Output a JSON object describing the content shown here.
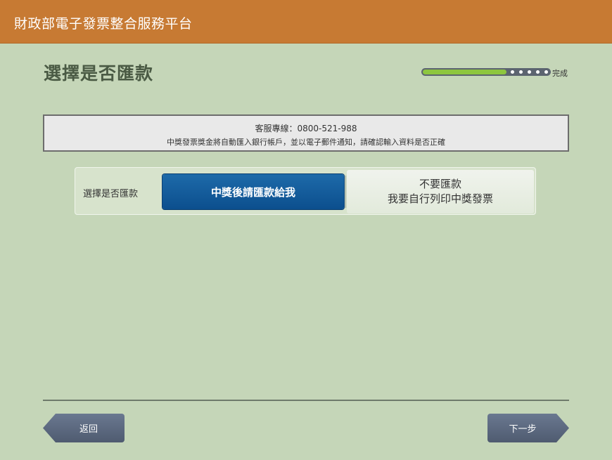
{
  "header": {
    "title": "財政部電子發票整合服務平台"
  },
  "page": {
    "title": "選擇是否匯款"
  },
  "progress": {
    "label": "完成",
    "fraction": 0.66
  },
  "notice": {
    "hotline": "客服專線：0800-521-988",
    "message": "中獎發票獎金將自動匯入銀行帳戶，並以電子郵件通知，請確認輸入資料是否正確"
  },
  "choice": {
    "label": "選擇是否匯款",
    "yes": "中獎後請匯款給我",
    "no_line1": "不要匯款",
    "no_line2": "我要自行列印中獎發票"
  },
  "nav": {
    "back": "返回",
    "next": "下一步"
  },
  "colors": {
    "header": "#c77a33",
    "background": "#c5d6b8",
    "selected": "#0c4f8e",
    "progress_fill": "#8dc63f"
  }
}
